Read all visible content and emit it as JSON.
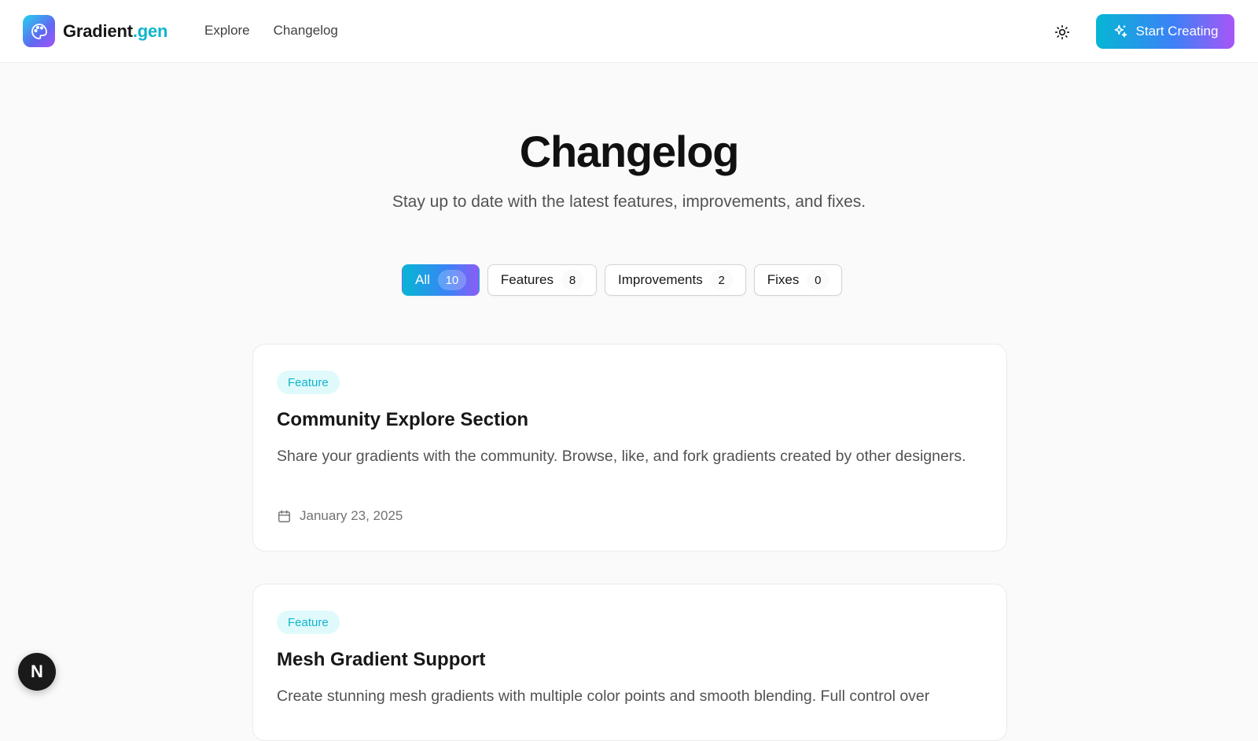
{
  "header": {
    "brand_main": "Gradient",
    "brand_suffix": ".gen",
    "nav": [
      {
        "label": "Explore"
      },
      {
        "label": "Changelog"
      }
    ],
    "theme_toggle_icon": "sun-icon",
    "cta_label": "Start Creating",
    "cta_icon": "sparkles-icon",
    "logo_icon": "palette-icon"
  },
  "page": {
    "title": "Changelog",
    "subtitle": "Stay up to date with the latest features, improvements, and fixes."
  },
  "filters": [
    {
      "label": "All",
      "count": "10",
      "active": true
    },
    {
      "label": "Features",
      "count": "8",
      "active": false
    },
    {
      "label": "Improvements",
      "count": "2",
      "active": false
    },
    {
      "label": "Fixes",
      "count": "0",
      "active": false
    }
  ],
  "entries": [
    {
      "badge": "Feature",
      "title": "Community Explore Section",
      "description": "Share your gradients with the community. Browse, like, and fork gradients created by other designers.",
      "date": "January 23, 2025",
      "date_icon": "calendar-icon"
    },
    {
      "badge": "Feature",
      "title": "Mesh Gradient Support",
      "description": "Create stunning mesh gradients with multiple color points and smooth blending. Full control over",
      "date": ""
    }
  ],
  "fab": {
    "label": "N"
  },
  "colors": {
    "accent_cyan": "#06b6d4",
    "accent_blue": "#3b82f6",
    "accent_purple": "#a855f7",
    "badge_bg": "#e0fafc",
    "badge_text": "#0fb5cc"
  }
}
